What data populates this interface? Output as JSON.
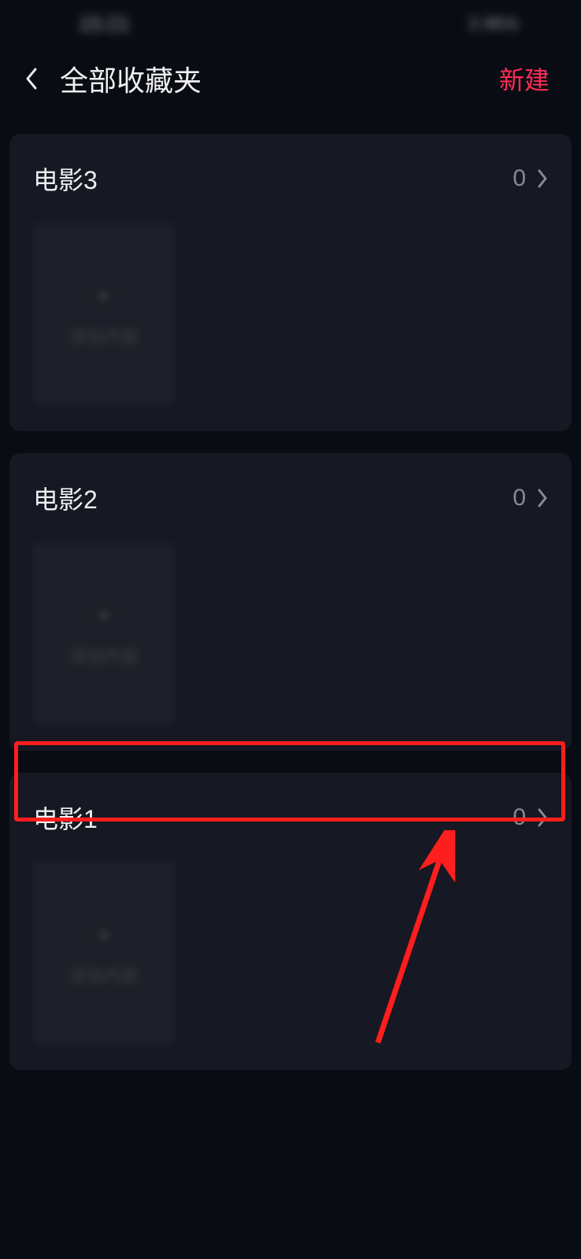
{
  "statusBar": {
    "time": "15:21",
    "right": "2.4K/s"
  },
  "header": {
    "title": "全部收藏夹",
    "action": "新建"
  },
  "folders": [
    {
      "name": "电影3",
      "count": "0"
    },
    {
      "name": "电影2",
      "count": "0"
    },
    {
      "name": "电影1",
      "count": "0"
    }
  ],
  "thumb": {
    "plus": "+",
    "label": "添加内容"
  }
}
